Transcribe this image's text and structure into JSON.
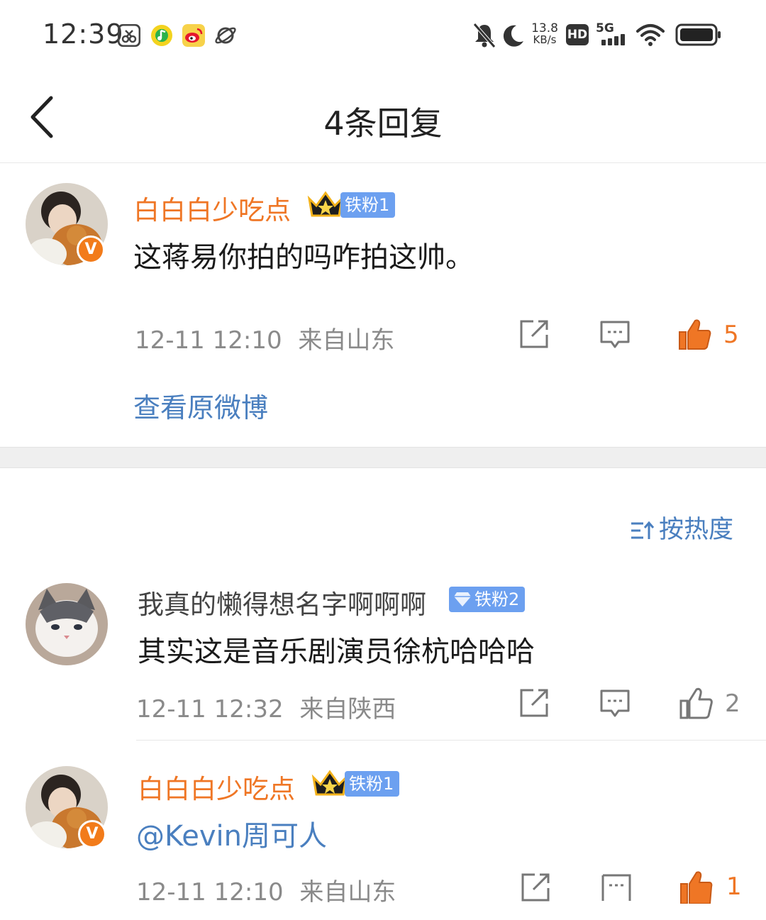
{
  "status_bar": {
    "time": "12:39",
    "net_speed_value": "13.8",
    "net_speed_unit": "KB/s",
    "hd_label": "HD",
    "signal_label": "5G",
    "icons": [
      "scissors-app-icon",
      "music-app-icon",
      "weibo-app-icon",
      "planet-app-icon",
      "mute-icon",
      "moon-icon",
      "wifi-icon",
      "battery-icon"
    ]
  },
  "header": {
    "title": "4条回复",
    "back_icon": "chevron-left-icon"
  },
  "root_comment": {
    "username": "白白白少吃点",
    "verified_badge": "V",
    "fan_badge": "铁粉1",
    "content": "这蒋易你拍的吗咋拍这帅。",
    "timestamp": "12-11 12:10",
    "location": "来自山东",
    "like_count": "5",
    "view_original": "查看原微博"
  },
  "sort": {
    "label": "按热度"
  },
  "replies": [
    {
      "username": "我真的懒得想名字啊啊啊",
      "fan_badge": "铁粉2",
      "content": "其实这是音乐剧演员徐杭哈哈哈",
      "timestamp": "12-11 12:32",
      "location": "来自陕西",
      "like_count": "2"
    },
    {
      "username": "白白白少吃点",
      "verified_badge": "V",
      "fan_badge": "铁粉1",
      "content": "@Kevin周可人",
      "timestamp": "12-11 12:10",
      "location": "来自山东",
      "like_count": "1"
    }
  ],
  "colors": {
    "accent_orange": "#ef7625",
    "link_blue": "#4a7fbf",
    "fan_badge_blue": "#6ca0f0"
  }
}
